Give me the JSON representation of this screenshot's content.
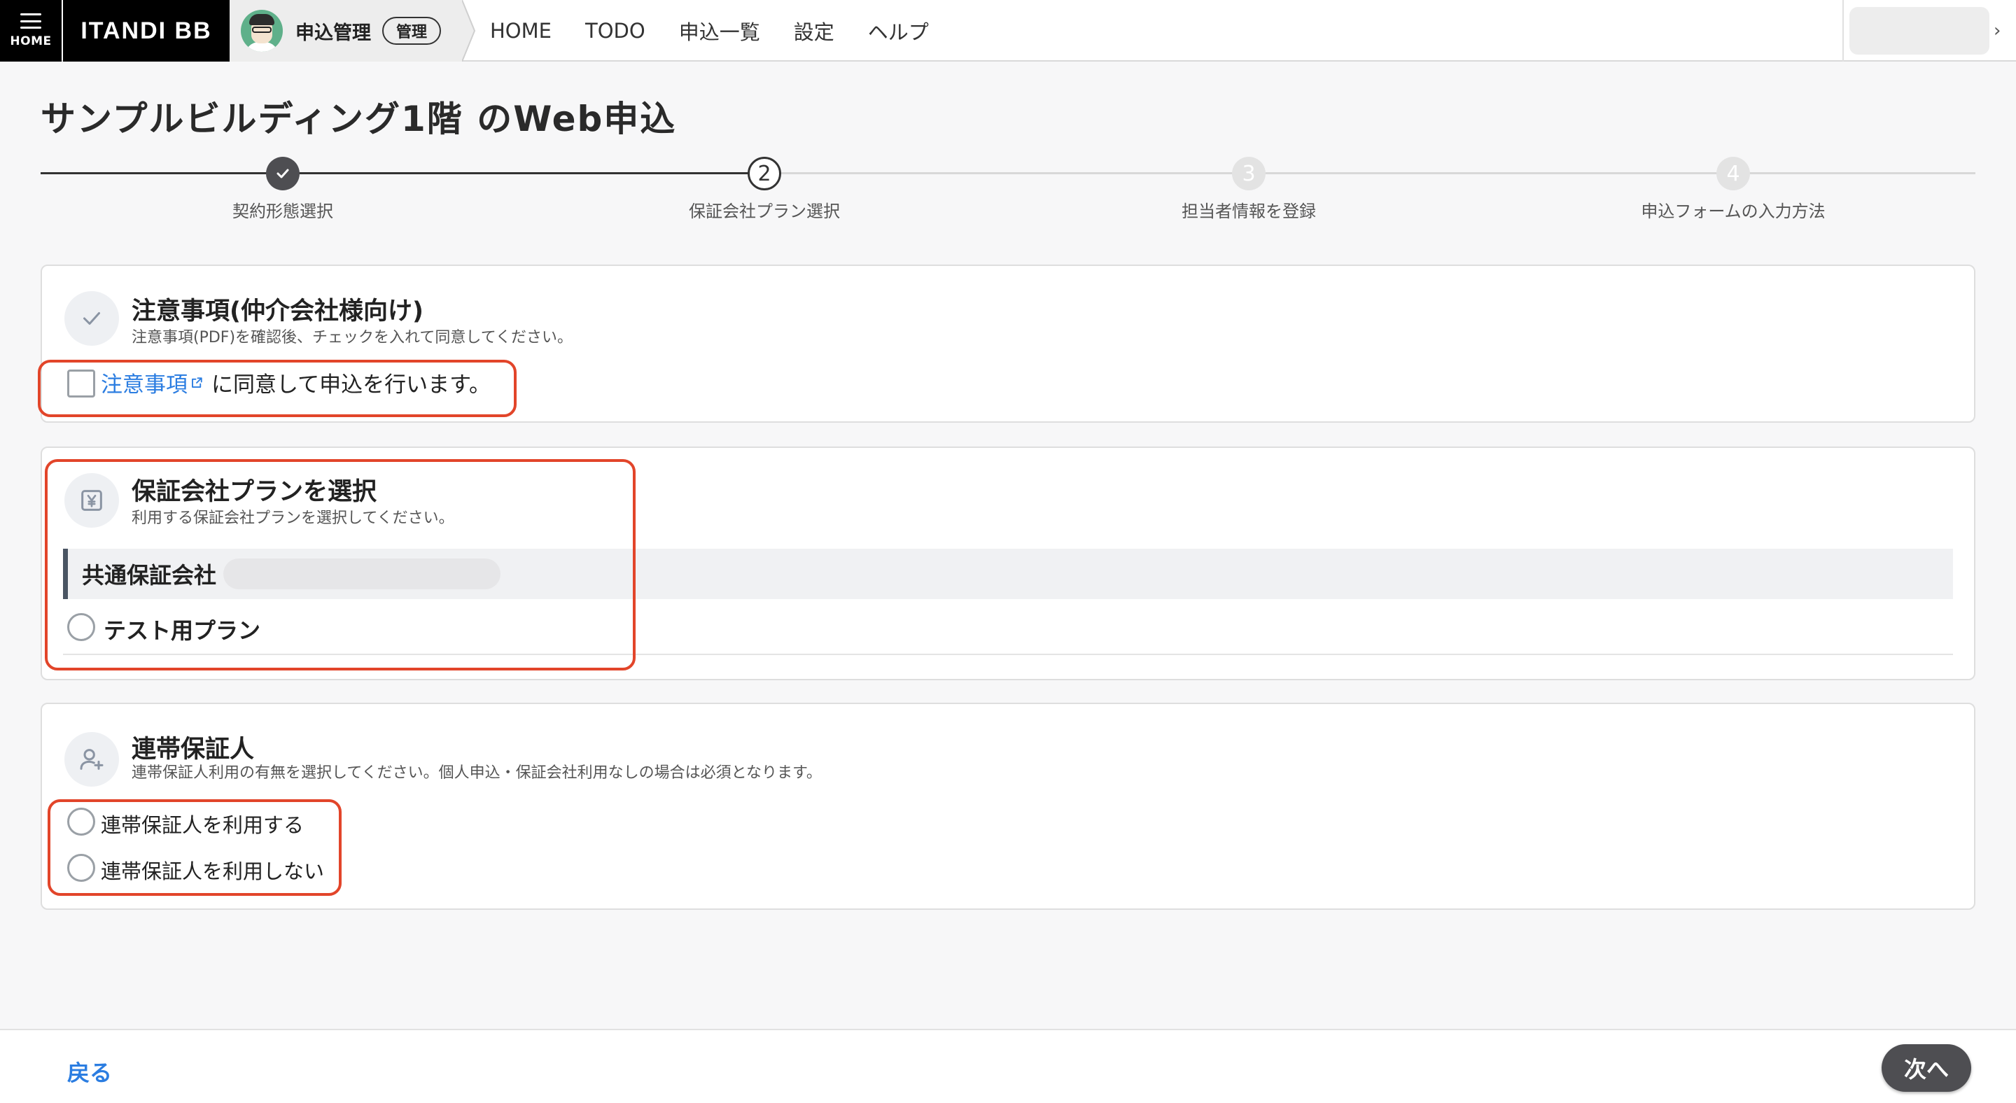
{
  "header": {
    "home_label": "HOME",
    "brand": "ITANDI BB",
    "app_name": "申込管理",
    "app_badge": "管理",
    "nav": [
      "HOME",
      "TODO",
      "申込一覧",
      "設定",
      "ヘルプ"
    ]
  },
  "page": {
    "title": "サンプルビルディング1階 のWeb申込"
  },
  "stepper": {
    "steps": [
      {
        "number": "1",
        "label": "契約形態選択",
        "state": "done"
      },
      {
        "number": "2",
        "label": "保証会社プラン選択",
        "state": "current"
      },
      {
        "number": "3",
        "label": "担当者情報を登録",
        "state": "upcoming"
      },
      {
        "number": "4",
        "label": "申込フォームの入力方法",
        "state": "upcoming"
      }
    ]
  },
  "notice": {
    "icon": "check-icon",
    "title": "注意事項(仲介会社様向け)",
    "subtitle": "注意事項(PDF)を確認後、チェックを入れて同意してください。",
    "link_text": "注意事項",
    "agree_text": "に同意して申込を行います。",
    "checked": false
  },
  "guarantee": {
    "icon": "yen-icon",
    "title": "保証会社プランを選択",
    "subtitle": "利用する保証会社プランを選択してください。",
    "group_label": "共通保証会社",
    "plans": [
      {
        "label": "テスト用プラン",
        "selected": false
      }
    ]
  },
  "cosigner": {
    "icon": "user-add-icon",
    "title": "連帯保証人",
    "subtitle": "連帯保証人利用の有無を選択してください。個人申込・保証会社利用なしの場合は必須となります。",
    "options": [
      {
        "label": "連帯保証人を利用する",
        "selected": false
      },
      {
        "label": "連帯保証人を利用しない",
        "selected": false
      }
    ]
  },
  "footer": {
    "back_label": "戻る",
    "next_label": "次へ"
  },
  "colors": {
    "accent_link": "#2b7de1",
    "highlight": "#e2452a",
    "step_done": "#4e4e52"
  }
}
